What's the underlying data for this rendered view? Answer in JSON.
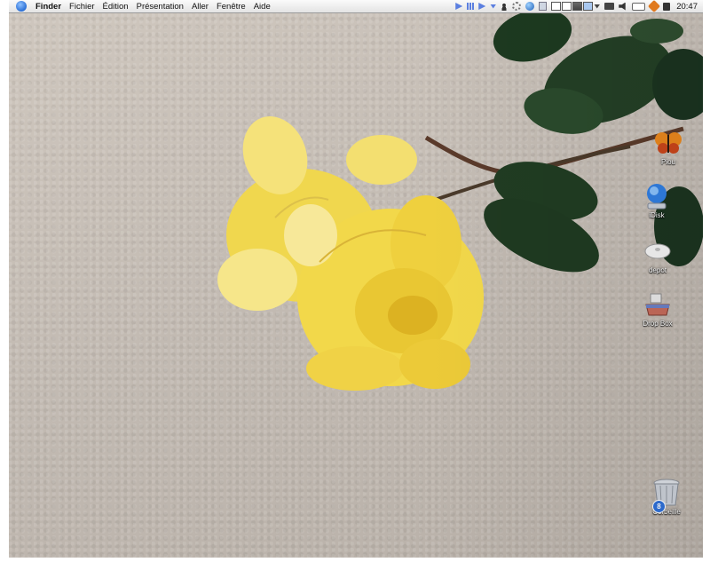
{
  "menubar": {
    "apple_icon": "apple-menu-icon",
    "items": [
      {
        "label": "Finder",
        "bold": true
      },
      {
        "label": "Fichier"
      },
      {
        "label": "Édition"
      },
      {
        "label": "Présentation"
      },
      {
        "label": "Aller"
      },
      {
        "label": "Fenêtre"
      },
      {
        "label": "Aide"
      }
    ],
    "clock": "20:47"
  },
  "desktop_icons": [
    {
      "label": "Piou",
      "icon": "butterfly-icon"
    },
    {
      "label": "iDisk",
      "icon": "idisk-icon"
    },
    {
      "label": "depot",
      "icon": "disk-icon"
    },
    {
      "label": "Drop Box",
      "icon": "drop-box-icon"
    },
    {
      "label": "Corbeille",
      "icon": "trash-icon",
      "badge": "8"
    }
  ],
  "colors": {
    "menubar": "#e9e9e9",
    "wall": "#c5bdb5",
    "rose": "#f2d84a",
    "leaf": "#1f3a22"
  }
}
